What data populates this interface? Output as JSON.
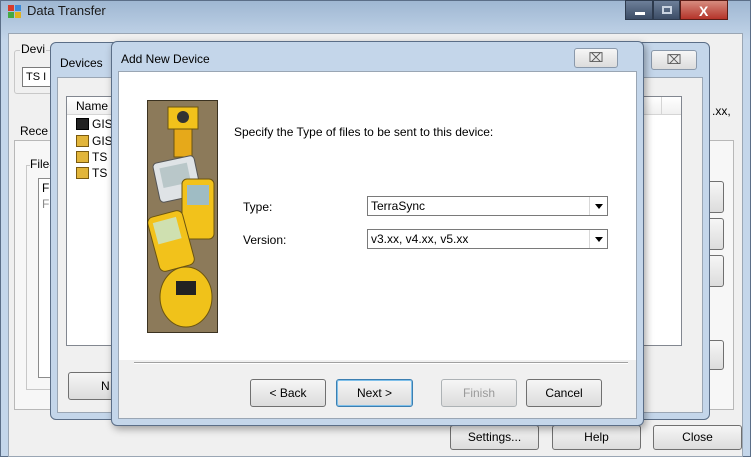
{
  "main_window": {
    "title": "Data Transfer",
    "device_group_label": "Devi",
    "device_combo_value": "TS I",
    "received_tab_label": "Rece",
    "files_group_label": "File",
    "list_header_partial": "F",
    "list_row_partial": "F",
    "version_partial_text": ".xx,",
    "left_button_label": "N",
    "settings_button_label": "Settings...",
    "help_button_label": "Help",
    "close_button_label": "Close"
  },
  "devices_dialog": {
    "title": "Devices",
    "list_header_name": "Name",
    "items": [
      {
        "label": "GIS",
        "icon": "handheld-device-icon"
      },
      {
        "label": "GIS",
        "icon": "folder-device-icon"
      },
      {
        "label": "TS",
        "icon": "folder-device-icon"
      },
      {
        "label": "TS",
        "icon": "folder-device-icon"
      }
    ]
  },
  "add_device_dialog": {
    "title": "Add New Device",
    "instruction": "Specify the Type of files to be sent to this device:",
    "type_label": "Type:",
    "type_value": "TerraSync",
    "version_label": "Version:",
    "version_value": "v3.xx, v4.xx, v5.xx",
    "back_label": "< Back",
    "next_label": "Next >",
    "finish_label": "Finish",
    "cancel_label": "Cancel"
  },
  "colors": {
    "desktop": "#8a8f96",
    "glass_frame": "#c4d6ea",
    "dialog_face": "#f0f0f0",
    "close_button_red": "#c75050",
    "illustration_bg": "#7a6a4e",
    "device_yellow": "#f2c21b"
  }
}
